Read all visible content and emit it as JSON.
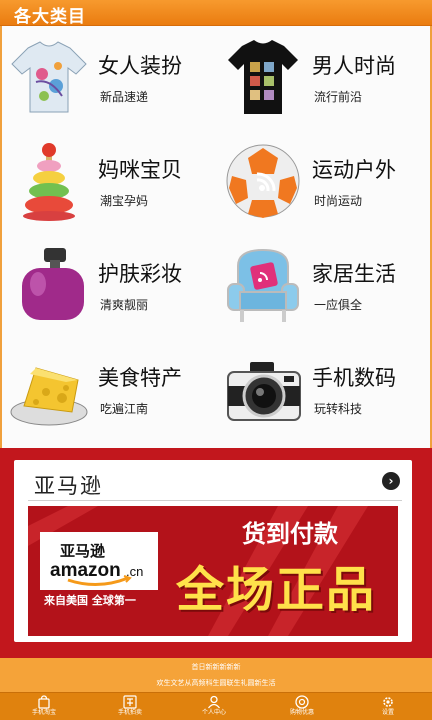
{
  "header": {
    "title": "各大类目"
  },
  "categories": [
    {
      "name": "女人装扮",
      "sub": "新品速递",
      "icon": "tshirt-icon"
    },
    {
      "name": "男人时尚",
      "sub": "流行前沿",
      "icon": "black-tshirt-icon"
    },
    {
      "name": "妈咪宝贝",
      "sub": "潮宝孕妈",
      "icon": "stacking-rings-toy-icon"
    },
    {
      "name": "运动户外",
      "sub": "时尚运动",
      "icon": "soccer-ball-icon"
    },
    {
      "name": "护肤彩妆",
      "sub": "清爽靓丽",
      "icon": "perfume-bottle-icon"
    },
    {
      "name": "家居生活",
      "sub": "一应俱全",
      "icon": "armchair-icon"
    },
    {
      "name": "美食特产",
      "sub": "吃遍江南",
      "icon": "cheese-icon"
    },
    {
      "name": "手机数码",
      "sub": "玩转科技",
      "icon": "camera-icon"
    }
  ],
  "promo": {
    "title": "亚马逊",
    "banner": {
      "logo_cn": "亚马逊",
      "logo_en": "amazon",
      "logo_suffix": ".cn",
      "tagline": "来自美国 全球第一",
      "headline_small": "货到付款",
      "headline_big": "全场正品"
    }
  },
  "footer": {
    "line1": "首日新新新新新",
    "line2": "欢生文艺从高频科生圆联生礼圆新生活"
  },
  "tabs": [
    {
      "label": "手机淘宝",
      "icon": "shopping-bag-icon"
    },
    {
      "label": "手机拍卖",
      "icon": "auction-icon"
    },
    {
      "label": "个人中心",
      "icon": "user-icon"
    },
    {
      "label": "购物优惠",
      "icon": "discount-icon"
    },
    {
      "label": "设置",
      "icon": "gear-icon"
    }
  ],
  "colors": {
    "accent": "#ea7c10",
    "promo_bg": "#c2171d",
    "headline_yellow": "#ffe14a"
  }
}
